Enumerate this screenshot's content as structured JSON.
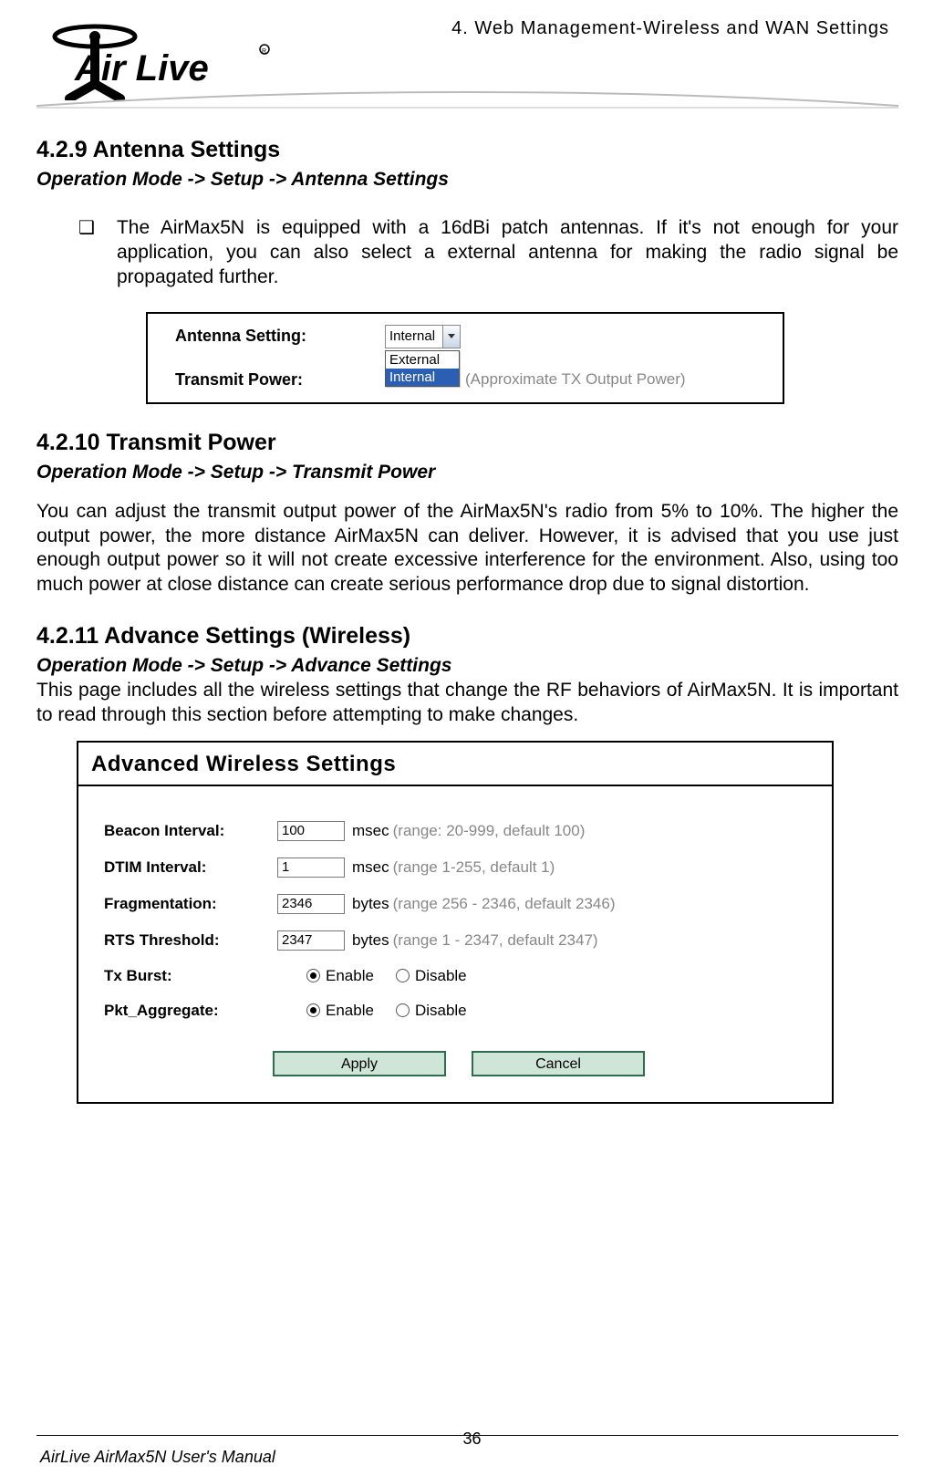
{
  "header": {
    "chapter": "4. Web Management-Wireless and WAN Settings",
    "logo_text": "Air Live"
  },
  "sections": {
    "s1": {
      "heading": "4.2.9 Antenna Settings",
      "breadcrumb": "Operation Mode -> Setup -> Antenna Settings",
      "bullet": "The AirMax5N is equipped with a 16dBi patch antennas. If it's not enough for your application, you can also select a external antenna for making the radio signal be propagated further."
    },
    "s2": {
      "heading": "4.2.10 Transmit Power",
      "breadcrumb": "Operation Mode -> Setup -> Transmit Power",
      "body": "You can adjust the transmit output power of the AirMax5N's radio from 5% to 10%. The higher the output power, the more distance AirMax5N can deliver. However, it is advised that you use just enough output power so it will not create excessive interference for the environment. Also, using too much power at close distance can create serious performance drop due to signal distortion."
    },
    "s3": {
      "heading": "4.2.11 Advance Settings (Wireless)",
      "breadcrumb": "Operation Mode -> Setup -> Advance Settings",
      "body": "This page includes all the wireless settings that change the RF behaviors of AirMax5N. It is important to read through this section before attempting to make changes."
    }
  },
  "antenna_panel": {
    "row1_label": "Antenna Setting:",
    "select_value": "Internal",
    "options": [
      "External",
      "Internal"
    ],
    "selected_option": "Internal",
    "row2_label": "Transmit Power:",
    "row2_hint": "(Approximate TX Output Power)"
  },
  "adv_panel": {
    "title": "Advanced Wireless Settings",
    "rows": {
      "beacon": {
        "label": "Beacon Interval:",
        "value": "100",
        "unit": "msec",
        "hint": "(range: 20-999, default 100)"
      },
      "dtim": {
        "label": "DTIM Interval:",
        "value": "1",
        "unit": "msec",
        "hint": "(range 1-255, default 1)"
      },
      "frag": {
        "label": "Fragmentation:",
        "value": "2346",
        "unit": "bytes",
        "hint": "(range 256 - 2346, default 2346)"
      },
      "rts": {
        "label": "RTS Threshold:",
        "value": "2347",
        "unit": "bytes",
        "hint": "(range 1 - 2347, default 2347)"
      },
      "txburst": {
        "label": "Tx Burst:",
        "enable": "Enable",
        "disable": "Disable",
        "checked": "enable"
      },
      "pktagg": {
        "label": "Pkt_Aggregate:",
        "enable": "Enable",
        "disable": "Disable",
        "checked": "enable"
      }
    },
    "buttons": {
      "apply": "Apply",
      "cancel": "Cancel"
    }
  },
  "footer": {
    "page_number": "36",
    "manual": "AirLive AirMax5N User's Manual"
  }
}
